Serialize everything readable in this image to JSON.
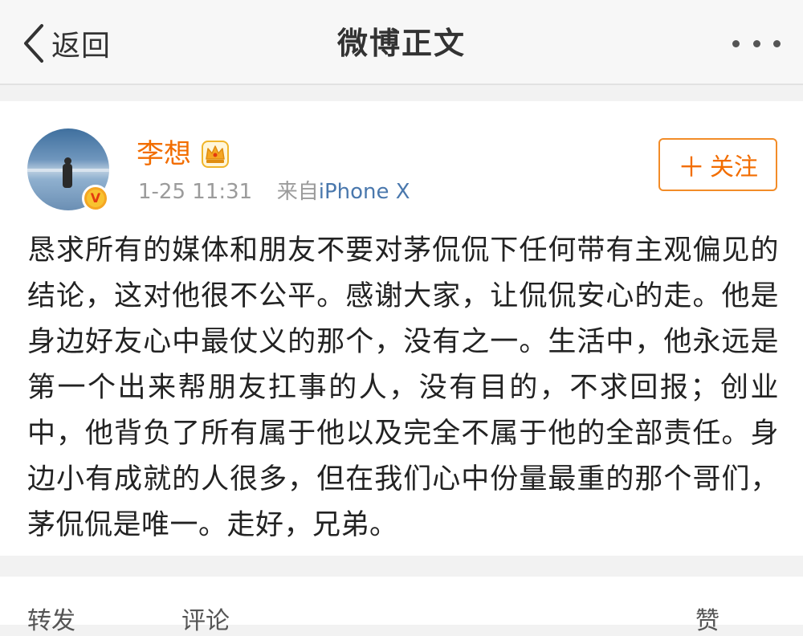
{
  "nav": {
    "back_label": "返回",
    "title": "微博正文"
  },
  "post": {
    "username": "李想",
    "time": "1-25 11:31",
    "source_prefix": "来自",
    "source_device": "iPhone X",
    "follow_label": "关注",
    "verified_badge": "V",
    "text": "恳求所有的媒体和朋友不要对茅侃侃下任何带有主观偏见的结论，这对他很不公平。感谢大家，让侃侃安心的走。他是身边好友心中最仗义的那个，没有之一。生活中，他永远是第一个出来帮朋友扛事的人，没有目的，不求回报；创业中，他背负了所有属于他以及完全不属于他的全部责任。身边小有成就的人很多，但在我们心中份量最重的那个哥们，茅侃侃是唯一。走好，兄弟。"
  },
  "actions": {
    "repost_label": "转发",
    "comment_label": "评论",
    "like_label": "赞"
  },
  "colors": {
    "accent_orange": "#f26d00",
    "link_blue": "#4a78ad"
  },
  "icons": [
    "back-chevron-icon",
    "more-icon",
    "crown-icon",
    "plus-icon",
    "verified-icon"
  ]
}
